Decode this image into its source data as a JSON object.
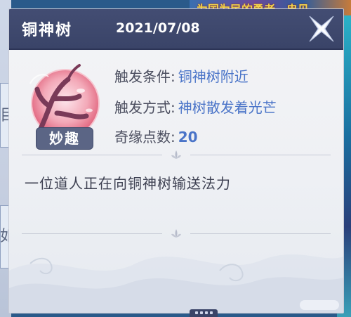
{
  "event": {
    "title": "铜神树",
    "date": "2021/07/08",
    "tag": "妙趣",
    "emblem_icon": "tree-branch-moon-icon",
    "close_icon": "close-x-icon",
    "trigger_condition": {
      "label": "触发条件:",
      "value": "铜神树附近"
    },
    "trigger_method": {
      "label": "触发方式:",
      "value": "神树散发着光芒"
    },
    "fortune_points": {
      "label": "奇缘点数:",
      "value": "20"
    },
    "description": "一位道人正在向铜神树输送法力"
  },
  "colors": {
    "header_bg": "#434d73",
    "value_text": "#4a74c8",
    "label_text": "#4a4d5e",
    "emblem_red": "#e86a80"
  }
}
